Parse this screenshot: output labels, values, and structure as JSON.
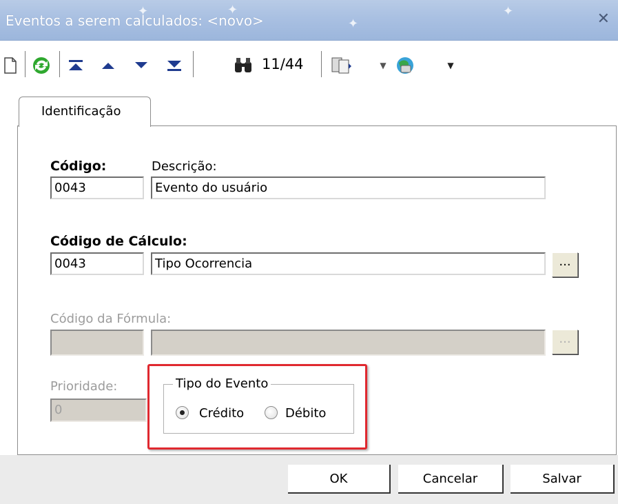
{
  "window": {
    "title": "Eventos a serem calculados: <novo>"
  },
  "toolbar": {
    "counter": "11/44",
    "icons": [
      "new-document-icon",
      "refresh-icon",
      "first-record-icon",
      "previous-record-icon",
      "next-record-icon",
      "last-record-icon",
      "find-icon",
      "copy-icon",
      "dropdown-arrow-icon",
      "web-icon",
      "dropdown-arrow-icon"
    ]
  },
  "tabs": [
    {
      "label": "Identificação"
    }
  ],
  "form": {
    "codigo_label": "Código:",
    "codigo_value": "0043",
    "descricao_label": "Descrição:",
    "descricao_value": "Evento do usuário",
    "calc_label": "Código de Cálculo:",
    "calc_code_value": "0043",
    "calc_desc_value": "Tipo Ocorrencia",
    "lookup_label": "...",
    "formula_label": "Código da Fórmula:",
    "formula_code_value": "",
    "formula_desc_value": "",
    "prioridade_label": "Prioridade:",
    "prioridade_value": "0"
  },
  "tipo_evento": {
    "legend": "Tipo do Evento",
    "options": [
      {
        "label": "Crédito",
        "selected": true
      },
      {
        "label": "Débito",
        "selected": false
      }
    ]
  },
  "footer": {
    "ok_label": "OK",
    "cancel_label": "Cancelar",
    "save_label": "Salvar"
  },
  "colors": {
    "highlight": "#e0282f",
    "title_bar": "#a9c0e2",
    "disabled_field": "#d4d0c8"
  }
}
